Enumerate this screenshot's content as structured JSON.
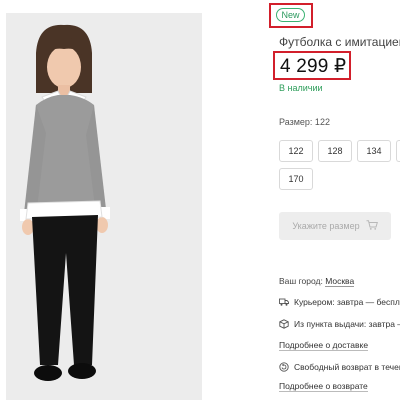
{
  "product": {
    "badge": "New",
    "title": "Футболка с имитацией",
    "price": "4 299 ₽",
    "availability": "В наличии",
    "size_label": "Размер: 122",
    "sizes": [
      "122",
      "128",
      "134",
      "170"
    ],
    "cta_label": "Укажите размер"
  },
  "delivery": {
    "city_label": "Ваш город:",
    "city_value": "Москва",
    "courier": "Курьером: завтра — беспла",
    "pickup": "Из пункта выдачи: завтра —",
    "delivery_link": "Подробнее о доставке",
    "returns": "Свободный возврат в течен",
    "returns_link": "Подробнее о возврате"
  },
  "icons": {
    "cart": "cart-icon",
    "truck": "truck-icon",
    "box": "box-icon",
    "return": "return-icon"
  },
  "colors": {
    "highlight": "#d21f2b",
    "badge": "#2b9a5e",
    "stock": "#2e9e5b"
  }
}
